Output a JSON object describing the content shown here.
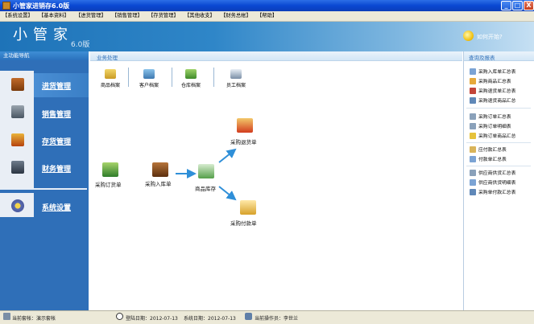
{
  "window": {
    "title": "小管家进销存6.0版",
    "buttons": {
      "minimize": "_",
      "maximize": "□",
      "close": "X"
    }
  },
  "menu": [
    "【系统设置】",
    "【基本资料】",
    "【进货管理】",
    "【销售管理】",
    "【存货管理】",
    "【其他收支】",
    "【财务总帐】",
    "【帮助】"
  ],
  "banner": {
    "title": "小管家",
    "version": "6.0版",
    "help": "如何开始?"
  },
  "sidebar": {
    "header": "主功能导航",
    "items": [
      {
        "label": "进货管理",
        "icon": "truck-icon",
        "active": true
      },
      {
        "label": "销售管理",
        "icon": "cash-register-icon",
        "active": false
      },
      {
        "label": "存货管理",
        "icon": "warehouse-icon",
        "active": false
      },
      {
        "label": "财务管理",
        "icon": "ledger-icon",
        "active": false
      },
      {
        "label": "系统设置",
        "icon": "gear-icon",
        "active": false
      }
    ]
  },
  "center": {
    "header": "业务处理",
    "files": [
      {
        "label": "商品档案",
        "icon": "product-file-icon"
      },
      {
        "label": "客户档案",
        "icon": "customer-file-icon"
      },
      {
        "label": "仓库档案",
        "icon": "warehouse-file-icon"
      },
      {
        "label": "员工档案",
        "icon": "employee-file-icon"
      }
    ],
    "flow": {
      "order": "采购订货单",
      "inbound": "采购入库单",
      "stock": "商品库存",
      "return": "采购退货单",
      "payment": "采购付款单"
    }
  },
  "right": {
    "header": "查询及报表",
    "groups": [
      [
        "采购入库单汇总表",
        "采购商品汇总表",
        "采购退货单汇总表",
        "采购退货商品汇总"
      ],
      [
        "采购订单汇总表",
        "采购订单明细表",
        "采购订单商品汇总"
      ],
      [
        "应付款汇总表",
        "付款单汇总表"
      ],
      [
        "供应商供货汇总表",
        "供应商供货明细表",
        "采购单付款汇总表"
      ]
    ]
  },
  "status": {
    "account_label": "当前套帐：演示套帐",
    "login_date": "登陆日期：2012-07-13",
    "system_date": "系统日期：2012-07-13",
    "operator": "当前操作员：李世兰"
  },
  "colors": {
    "titlebar": "#0a48d2",
    "sidebar": "#2f6fb8",
    "flow_arrow": "#2f8fd8"
  }
}
